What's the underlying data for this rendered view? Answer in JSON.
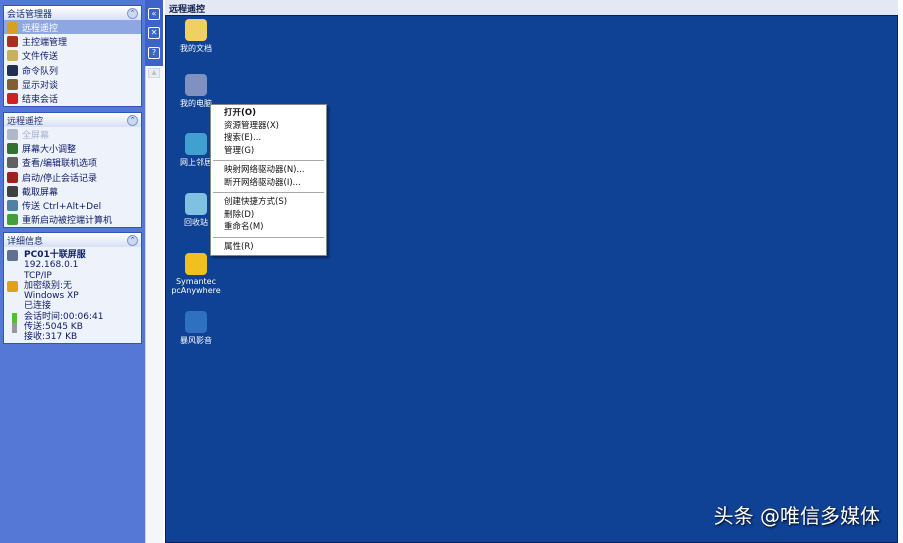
{
  "session_panel": {
    "title": "会话管理器",
    "items": [
      {
        "label": "远程遥控",
        "icon": "remote-icon",
        "color": "#d8a020"
      },
      {
        "label": "主控端管理",
        "icon": "host-icon",
        "color": "#a83020"
      },
      {
        "label": "文件传送",
        "icon": "file-transfer-icon",
        "color": "#c8b060"
      },
      {
        "label": "命令队列",
        "icon": "command-queue-icon",
        "color": "#203050"
      },
      {
        "label": "显示对谈",
        "icon": "chat-icon",
        "color": "#806030"
      },
      {
        "label": "结束会话",
        "icon": "end-session-icon",
        "color": "#d02020"
      }
    ]
  },
  "remote_panel": {
    "title": "远程遥控",
    "items": [
      {
        "label": "全屏幕",
        "icon": "fullscreen-icon",
        "color": "#b0b8c8"
      },
      {
        "label": "屏幕大小调整",
        "icon": "resize-icon",
        "color": "#307030"
      },
      {
        "label": "查看/编辑联机选项",
        "icon": "options-icon",
        "color": "#606060"
      },
      {
        "label": "启动/停止会话记录",
        "icon": "record-icon",
        "color": "#a02020"
      },
      {
        "label": "截取屏幕",
        "icon": "screenshot-icon",
        "color": "#404040"
      },
      {
        "label": "传送 Ctrl+Alt+Del",
        "icon": "ctrl-alt-del-icon",
        "color": "#5080a0"
      },
      {
        "label": "重新启动被控端计算机",
        "icon": "restart-icon",
        "color": "#40a040"
      }
    ]
  },
  "details_panel": {
    "title": "详细信息",
    "host": "PC01十联屏服",
    "ip": "192.168.0.1",
    "protocol": "TCP/IP",
    "encryption": "加密级别:无",
    "os": "Windows XP",
    "status": "已连接",
    "session_time": "会话时间:00:06:41",
    "sent": "传送:5045 KB",
    "received": "接收:317 KB"
  },
  "toolbar": {
    "collapse": "«",
    "close": "✕",
    "help": "?"
  },
  "main": {
    "title": "远程遥控",
    "desktop_icons": [
      {
        "label": "我的文档",
        "color": "#f0d060"
      },
      {
        "label": "我的电脑",
        "color": "#8090c0"
      },
      {
        "label": "网上邻居",
        "color": "#40a0d0"
      },
      {
        "label": "回收站",
        "color": "#80c0e0"
      },
      {
        "label": "Symantec pcAnywhere",
        "color": "#f0c020"
      },
      {
        "label": "暴风影音",
        "color": "#3070c0"
      }
    ]
  },
  "context_menu": [
    [
      "打开(O)",
      "资源管理器(X)",
      "搜索(E)...",
      "管理(G)"
    ],
    [
      "映射网络驱动器(N)...",
      "断开网络驱动器(I)..."
    ],
    [
      "创建快捷方式(S)",
      "删除(D)",
      "重命名(M)"
    ],
    [
      "属性(R)"
    ]
  ],
  "watermark": "头条 @唯信多媒体"
}
